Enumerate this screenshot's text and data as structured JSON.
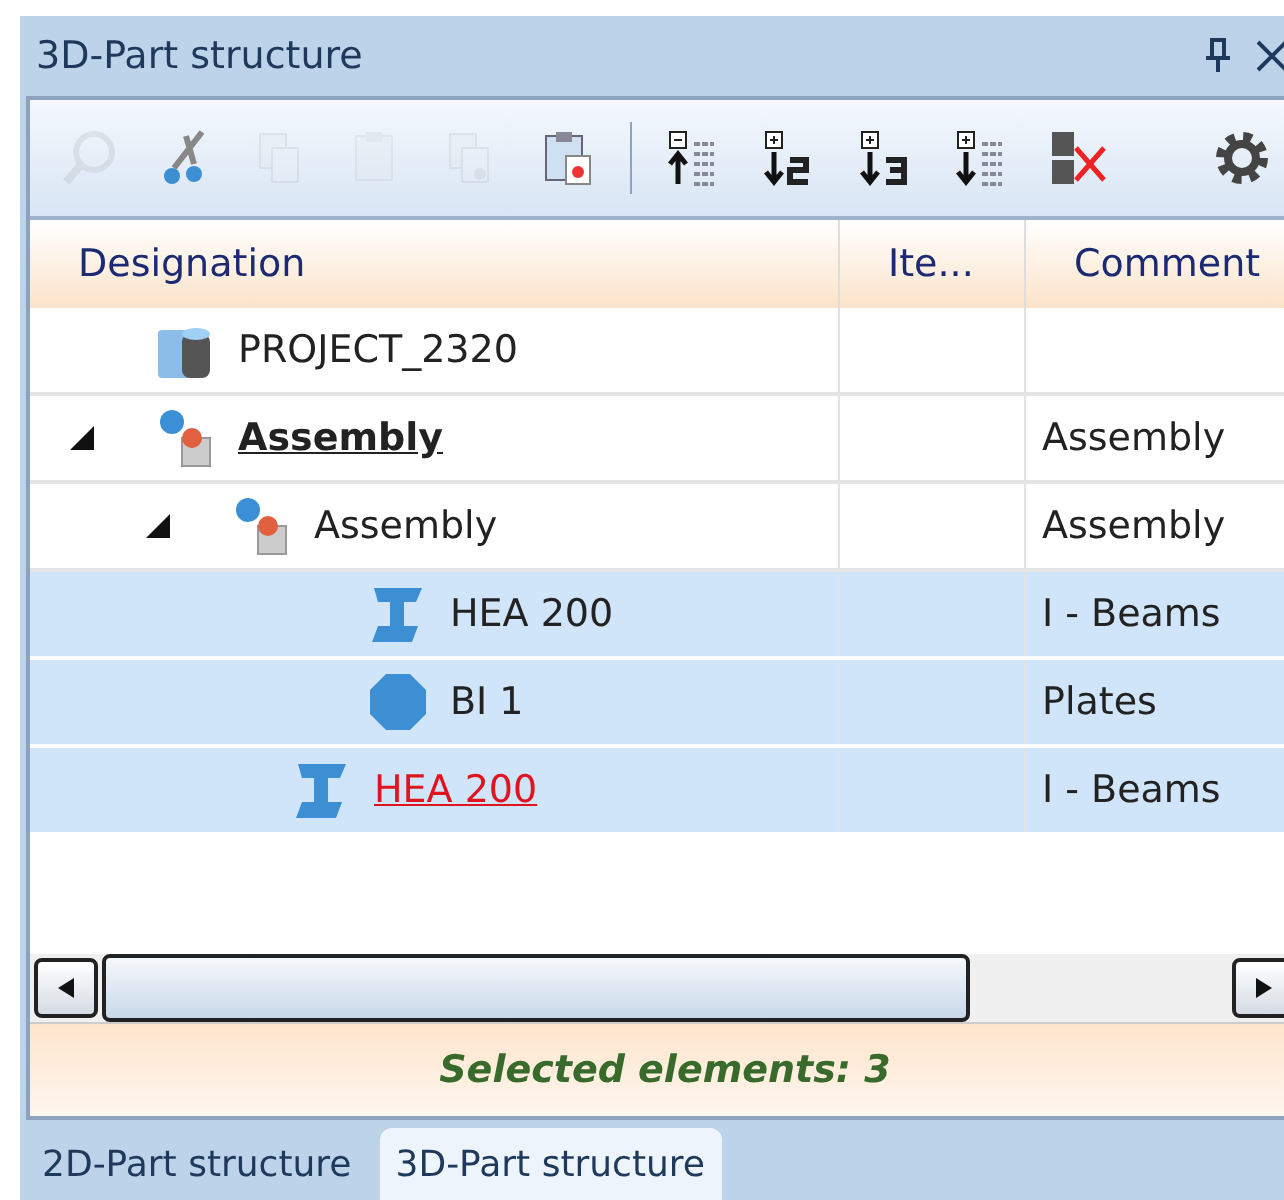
{
  "panel": {
    "title": "3D-Part structure"
  },
  "toolbar": [
    {
      "kind": "find",
      "disabled": true
    },
    {
      "kind": "cut",
      "disabled": false
    },
    {
      "kind": "copy",
      "disabled": true
    },
    {
      "kind": "paste",
      "disabled": true
    },
    {
      "kind": "paste-special",
      "disabled": true
    },
    {
      "kind": "paste-new",
      "disabled": false
    },
    {
      "kind": "separator"
    },
    {
      "kind": "collapse",
      "disabled": false
    },
    {
      "kind": "level2",
      "disabled": false
    },
    {
      "kind": "level3",
      "disabled": false
    },
    {
      "kind": "expand",
      "disabled": false
    },
    {
      "kind": "unsort",
      "disabled": false
    },
    {
      "kind": "settings",
      "disabled": false
    }
  ],
  "table": {
    "columns": [
      "Designation",
      "Ite...",
      "Comment"
    ],
    "rows": [
      {
        "designation": "PROJECT_2320",
        "kind": "project",
        "active": false,
        "invalid": false,
        "selected": false
      },
      {
        "designation": "Assembly",
        "kind": "assembly",
        "active": true,
        "invalid": false,
        "selected": false,
        "expanded": true,
        "comment": "Assembly",
        "children": [
          {
            "designation": "Assembly",
            "kind": "assembly",
            "active": false,
            "invalid": false,
            "selected": false,
            "expanded": true,
            "comment": "Assembly",
            "children": [
              {
                "designation": "HEA 200",
                "kind": "beam",
                "active": false,
                "invalid": false,
                "selected": true,
                "comment": "I - Beams"
              },
              {
                "designation": "BI 1",
                "kind": "plate",
                "active": false,
                "invalid": false,
                "selected": true,
                "comment": "Plates"
              }
            ]
          },
          {
            "designation": "HEA 200",
            "kind": "beam",
            "active": false,
            "invalid": true,
            "selected": true,
            "comment": "I - Beams"
          }
        ]
      }
    ]
  },
  "status_bar": "Selected elements: 3",
  "tabs": [
    {
      "label": "2D-Part structure",
      "selected": false
    },
    {
      "label": "3D-Part structure",
      "selected": true
    }
  ]
}
